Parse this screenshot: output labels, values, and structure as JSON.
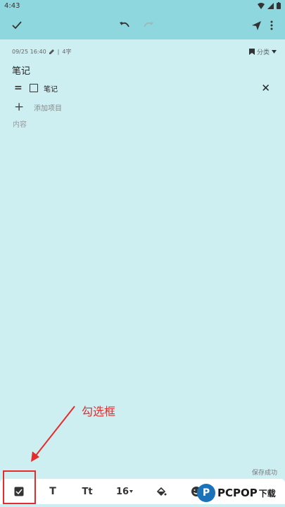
{
  "status_bar": {
    "time": "4:43"
  },
  "note": {
    "date": "09/25 16:40",
    "word_count": "4字",
    "category": "分类",
    "title": "笔记",
    "checklist": [
      {
        "text": "笔记",
        "checked": false
      }
    ],
    "add_item": "添加项目",
    "content_placeholder": "内容"
  },
  "annotation": {
    "label": "勾选框"
  },
  "save_status": "保存成功",
  "bottom_toolbar": {
    "bold_label": "T",
    "text_size_label": "Tt",
    "font_size_label": "16",
    "icons": [
      "checkbox-icon",
      "bold-icon",
      "text-style-icon",
      "font-size-icon",
      "fill-color-icon",
      "emoji-icon"
    ]
  },
  "watermark": {
    "brand": "PCPOP",
    "suffix": "下载"
  },
  "colors": {
    "toolbar": "#8fd7de",
    "background": "#ceeff2",
    "annotation": "#e52b2b"
  }
}
